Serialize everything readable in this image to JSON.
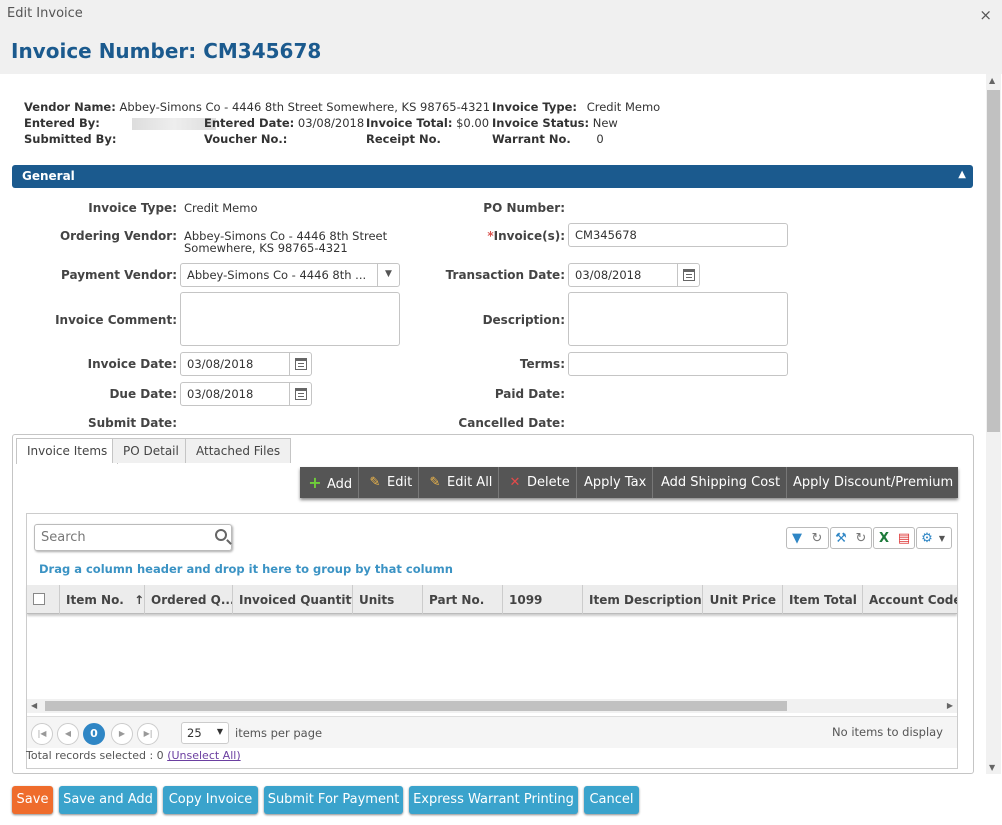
{
  "dialog": {
    "title": "Edit Invoice",
    "close": "×"
  },
  "header": {
    "title": "Invoice Number: CM345678"
  },
  "summary": {
    "vendor_name_k": "Vendor Name:",
    "vendor_name_v": "Abbey-Simons Co - 4446 8th Street Somewhere, KS 98765-4321",
    "entered_by_k": "Entered By:",
    "entered_date_k": "Entered Date:",
    "entered_date_v": "03/08/2018",
    "invoice_total_k": "Invoice Total:",
    "invoice_total_v": "$0.00",
    "submitted_by_k": "Submitted By:",
    "voucher_k": "Voucher No.:",
    "receipt_k": "Receipt No.",
    "invoice_type_k": "Invoice Type:",
    "invoice_type_v": "Credit Memo",
    "invoice_status_k": "Invoice Status:",
    "invoice_status_v": "New",
    "warrant_k": "Warrant No.",
    "warrant_v": "0"
  },
  "general": {
    "title": "General",
    "invoice_type_label": "Invoice Type:",
    "invoice_type_value": "Credit Memo",
    "ordering_vendor_label": "Ordering Vendor:",
    "ordering_vendor_line1": "Abbey-Simons Co - 4446 8th Street",
    "ordering_vendor_line2": "Somewhere, KS 98765-4321",
    "payment_vendor_label": "Payment Vendor:",
    "payment_vendor_value": "Abbey-Simons Co -  4446 8th ...",
    "invoice_comment_label": "Invoice Comment:",
    "invoice_date_label": "Invoice Date:",
    "invoice_date_value": "03/08/2018",
    "due_date_label": "Due Date:",
    "due_date_value": "03/08/2018",
    "submit_date_label": "Submit Date:",
    "po_number_label": "PO Number:",
    "invoices_req": "*",
    "invoices_label": "Invoice(s):",
    "invoices_value": "CM345678",
    "transaction_date_label": "Transaction Date:",
    "transaction_date_value": "03/08/2018",
    "description_label": "Description:",
    "terms_label": "Terms:",
    "paid_date_label": "Paid Date:",
    "cancelled_date_label": "Cancelled Date:"
  },
  "tabs": [
    "Invoice Items",
    "PO Detail",
    "Attached Files"
  ],
  "toolbar": {
    "add": "Add",
    "edit": "Edit",
    "edit_all": "Edit All",
    "delete": "Delete",
    "apply_tax": "Apply Tax",
    "add_shipping": "Add Shipping Cost",
    "apply_discount": "Apply Discount/Premium"
  },
  "grid": {
    "search_placeholder": "Search",
    "drag_hint": "Drag a column header and drop it here to group by that column",
    "columns": [
      "Item No.",
      "Ordered Q...",
      "Invoiced Quantity",
      "Units",
      "Part No.",
      "1099",
      "Item Description",
      "Unit Price",
      "Item Total",
      "Account Code"
    ],
    "sort_indicator": "↑",
    "page_current": "0",
    "page_size": "25",
    "items_per_page": "items per page",
    "no_items": "No items to display",
    "total_selected": "Total records selected : 0",
    "unselect_all": "(Unselect All)"
  },
  "buttons": {
    "save": "Save",
    "save_add": "Save and Add",
    "copy": "Copy Invoice",
    "submit": "Submit For Payment",
    "express": "Express Warrant Printing",
    "cancel": "Cancel"
  },
  "colors": {
    "brand": "#1b5a8e",
    "save": "#ef6c2c",
    "button": "#3aa3cc",
    "pager_active": "#2f86c5"
  }
}
